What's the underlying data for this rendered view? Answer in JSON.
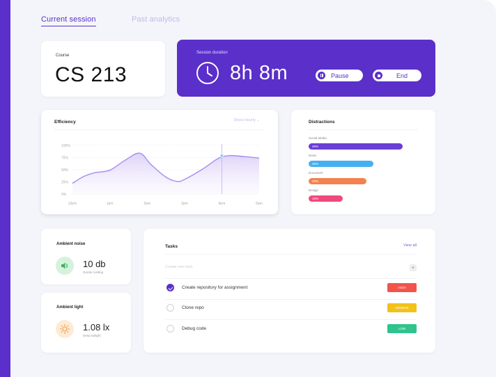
{
  "tabs": [
    {
      "label": "Current session"
    },
    {
      "label": "Past analytics"
    }
  ],
  "course": {
    "label": "Course",
    "value": "CS 213"
  },
  "session": {
    "label": "Session duration",
    "value": "8h 8m",
    "pause_label": "Pause",
    "end_label": "End"
  },
  "efficiency": {
    "title": "Efficiency",
    "selector": "Show Hourly"
  },
  "chart_data": {
    "type": "area",
    "title": "Efficiency",
    "x": [
      "12pm",
      "1pm",
      "2pm",
      "3pm",
      "4pm",
      "5pm"
    ],
    "y_ticks": [
      "0%",
      "25%",
      "50%",
      "75%",
      "100%"
    ],
    "ylim": [
      0,
      100
    ],
    "series": [
      {
        "x_pos": [
          0,
          0.3,
          0.6,
          1,
          1.4,
          1.8,
          2.1,
          2.5,
          2.8,
          3,
          3.5,
          3.9,
          4.2,
          4.6,
          5
        ],
        "values": [
          22,
          36,
          44,
          49,
          69,
          84,
          61,
          35,
          26,
          30,
          52,
          73,
          79,
          77,
          74
        ]
      }
    ],
    "highlight_x": 4,
    "grid": true,
    "colors": {
      "line": "#a58cf0",
      "fill": "#ece6fb"
    }
  },
  "distractions": {
    "title": "Distractions",
    "items": [
      {
        "label": "Social Media",
        "value": "45%",
        "color": "#6a3fd6",
        "fraction": 0.86
      },
      {
        "label": "News",
        "value": "25%",
        "color": "#45b0f0",
        "fraction": 0.59
      },
      {
        "label": "Document",
        "value": "20%",
        "color": "#f3824e",
        "fraction": 0.53
      },
      {
        "label": "Design",
        "value": "10%",
        "color": "#ef4a7d",
        "fraction": 0.31
      }
    ]
  },
  "noise": {
    "title": "Ambient noise",
    "value": "10 db",
    "sub": "Gentle rustling"
  },
  "light": {
    "title": "Ambient light",
    "value": "1.08 lx",
    "sub": "Deep twilight"
  },
  "tasks": {
    "title": "Tasks",
    "view_all": "View all",
    "create_placeholder": "Create new task",
    "add_symbol": "+",
    "items": [
      {
        "text": "Create repository for assignment",
        "done": true,
        "badge": "HIGH",
        "badge_color": "#f2544c"
      },
      {
        "text": "Clone repo",
        "done": false,
        "badge": "MEDIUM",
        "badge_color": "#f3c21a"
      },
      {
        "text": "Debug code",
        "done": false,
        "badge": "LOW",
        "badge_color": "#2fc48d"
      }
    ]
  },
  "colors": {
    "accent": "#5b2fc9",
    "background": "#f4f5fa",
    "noise_icon_bg": "#d6f2dd",
    "noise_icon": "#3bb55c",
    "light_icon_bg": "#fdebd6",
    "light_icon": "#f2a34a"
  },
  "icons": {
    "clock": "clock-icon",
    "pause": "pause-icon",
    "stop": "stop-icon",
    "speaker": "speaker-icon",
    "sun": "sun-icon",
    "check": "check-icon",
    "plus": "plus-icon"
  }
}
